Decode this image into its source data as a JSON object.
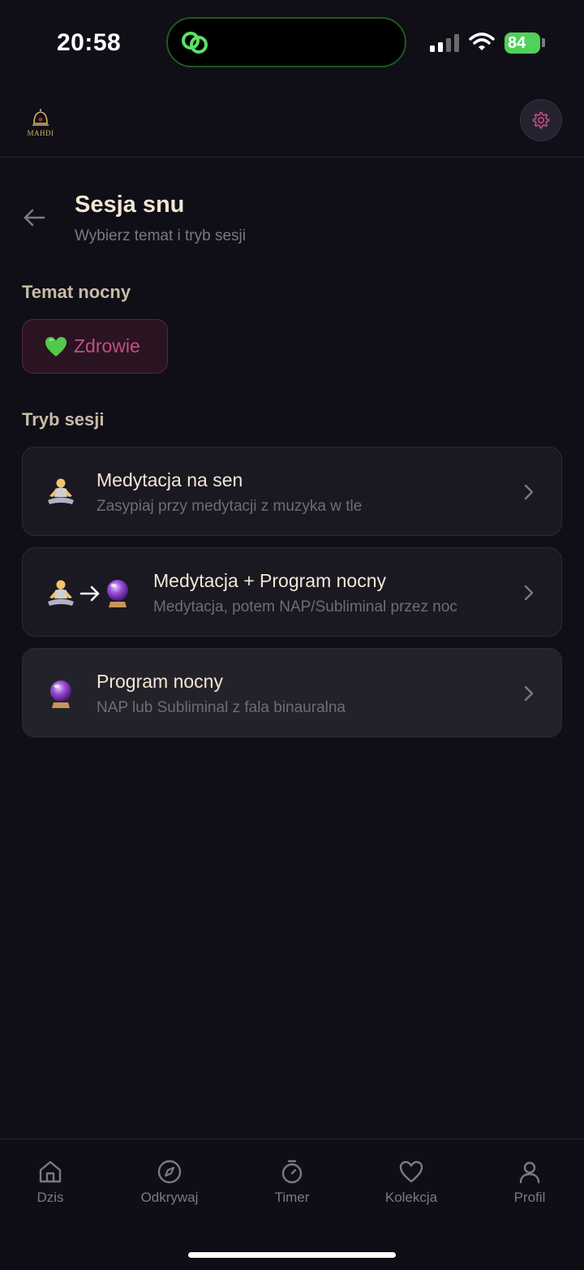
{
  "status_bar": {
    "time": "20:58",
    "battery": "84"
  },
  "header": {
    "logo_text": "MAHDI"
  },
  "page": {
    "title": "Sesja snu",
    "subtitle": "Wybierz temat i tryb sesji"
  },
  "theme_section": {
    "label": "Temat nocny",
    "chip": {
      "label": "Zdrowie",
      "icon": "green-heart-icon"
    }
  },
  "mode_section": {
    "label": "Tryb sesji",
    "modes": [
      {
        "title": "Medytacja na sen",
        "description": "Zasypiaj przy medytacji z muzyka w tle",
        "icons": [
          "meditation-icon"
        ]
      },
      {
        "title": "Medytacja + Program nocny",
        "description": "Medytacja, potem NAP/Subliminal przez noc",
        "icons": [
          "meditation-icon",
          "arrow-right-icon",
          "crystal-ball-icon"
        ]
      },
      {
        "title": "Program nocny",
        "description": "NAP lub Subliminal z fala binauralna",
        "icons": [
          "crystal-ball-icon"
        ]
      }
    ]
  },
  "tabbar": {
    "tabs": [
      {
        "label": "Dzis",
        "icon": "home-icon"
      },
      {
        "label": "Odkrywaj",
        "icon": "compass-icon"
      },
      {
        "label": "Timer",
        "icon": "timer-icon"
      },
      {
        "label": "Kolekcja",
        "icon": "heart-icon"
      },
      {
        "label": "Profil",
        "icon": "user-icon"
      }
    ]
  },
  "colors": {
    "background": "#100e17",
    "accent": "#c24e85",
    "text_primary": "#f3e7d3",
    "text_muted": "#7c7886"
  }
}
